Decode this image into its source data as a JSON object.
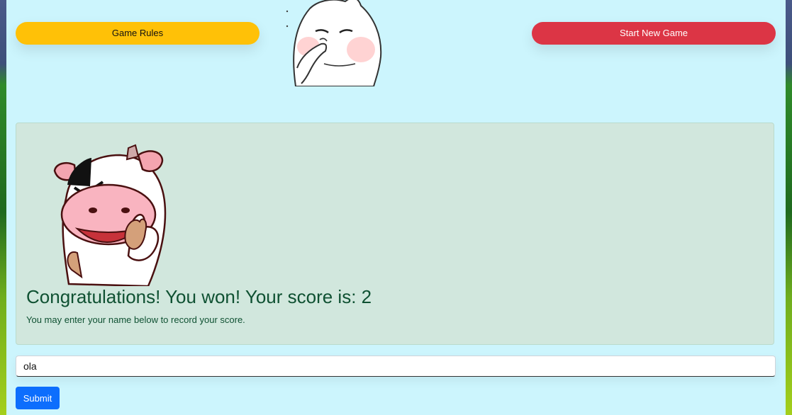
{
  "header": {
    "rules_label": "Game Rules",
    "new_game_label": "Start New Game"
  },
  "result": {
    "title": "Congratulations! You won! Your score is: 2",
    "message": "You may enter your name below to record your score."
  },
  "form": {
    "name_value": "ola",
    "submit_label": "Submit"
  },
  "colors": {
    "rules_button": "#ffc107",
    "new_game_button": "#dc3545",
    "submit_button": "#0d6efd",
    "page_bg": "#ccf5fd",
    "success_bg": "#d1e7dd",
    "success_text": "#0f5132"
  },
  "icons": {
    "header_image": "shy-cat-mascot",
    "result_image": "happy-cow-thumbs-up"
  }
}
